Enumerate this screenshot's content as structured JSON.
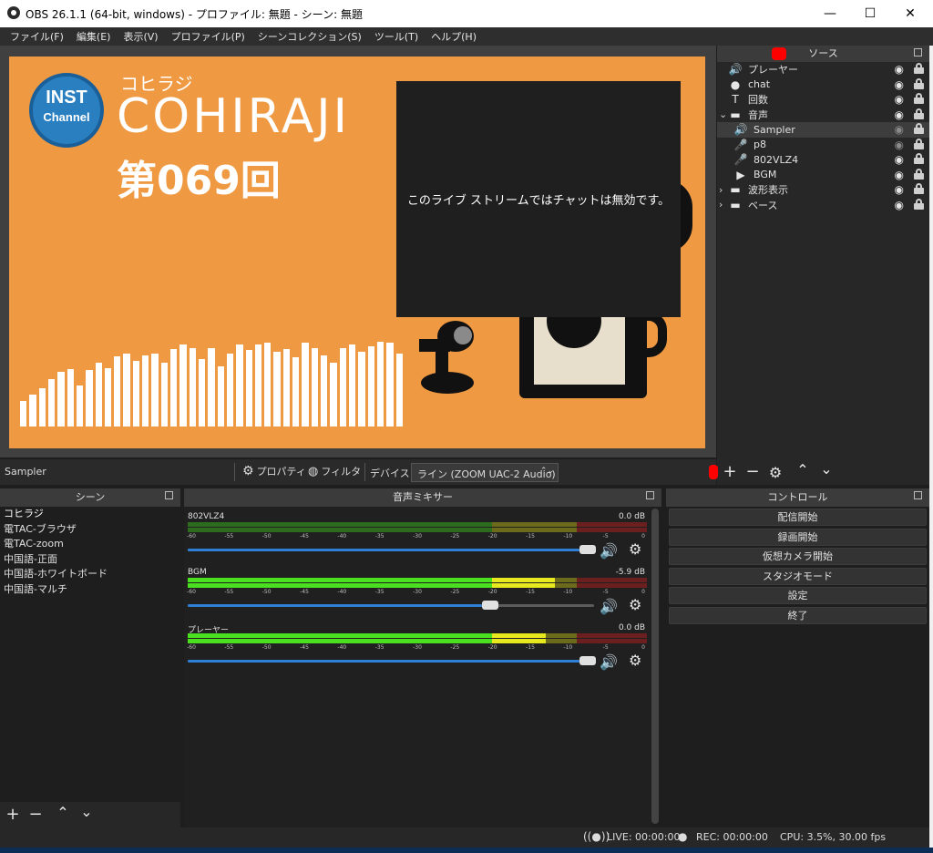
{
  "window": {
    "title": "OBS 26.1.1 (64-bit, windows) - プロファイル: 無題 - シーン: 無題",
    "minimize": "—",
    "maximize": "☐",
    "close": "✕"
  },
  "menu": [
    "ファイル(F)",
    "編集(E)",
    "表示(V)",
    "プロファイル(P)",
    "シーンコレクション(S)",
    "ツール(T)",
    "ヘルプ(H)"
  ],
  "preview": {
    "logo_line1": "INST",
    "logo_line2": "Channel",
    "show_kana": "コヒラジ",
    "show_name": "COHIRAJI",
    "episode": "第069回",
    "chat_message": "このライブ ストリームではチャットは無効です。",
    "visualizer_levels": [
      0.28,
      0.35,
      0.42,
      0.52,
      0.6,
      0.63,
      0.45,
      0.62,
      0.7,
      0.64,
      0.77,
      0.8,
      0.72,
      0.78,
      0.8,
      0.7,
      0.85,
      0.9,
      0.86,
      0.74,
      0.86,
      0.66,
      0.8,
      0.9,
      0.84,
      0.9,
      0.92,
      0.82,
      0.85,
      0.76,
      0.92,
      0.86,
      0.78,
      0.7,
      0.86,
      0.9,
      0.82,
      0.88,
      0.93,
      0.92,
      0.8
    ]
  },
  "sources": {
    "title": "ソース",
    "items": [
      {
        "name": "プレーヤー",
        "icon": "speaker-icon",
        "glyph": "🔊",
        "visible": true,
        "locked": true,
        "group": false,
        "indent": false,
        "selected": false
      },
      {
        "name": "chat",
        "icon": "globe-icon",
        "glyph": "●",
        "visible": true,
        "locked": true,
        "group": false,
        "indent": false,
        "selected": false
      },
      {
        "name": "回数",
        "icon": "text-icon",
        "glyph": "T",
        "visible": true,
        "locked": true,
        "group": false,
        "indent": false,
        "selected": false
      },
      {
        "name": "音声",
        "icon": "folder-icon",
        "glyph": "▬",
        "visible": true,
        "locked": true,
        "group": true,
        "expanded": true,
        "indent": false,
        "selected": false
      },
      {
        "name": "Sampler",
        "icon": "speaker-icon",
        "glyph": "🔊",
        "visible": false,
        "locked": true,
        "group": false,
        "indent": true,
        "selected": true
      },
      {
        "name": "p8",
        "icon": "mic-icon",
        "glyph": "🎤",
        "visible": false,
        "locked": true,
        "group": false,
        "indent": true,
        "selected": false
      },
      {
        "name": "802VLZ4",
        "icon": "mic-icon",
        "glyph": "🎤",
        "visible": true,
        "locked": true,
        "group": false,
        "indent": true,
        "selected": false
      },
      {
        "name": "BGM",
        "icon": "play-icon",
        "glyph": "▶",
        "visible": true,
        "locked": true,
        "group": false,
        "indent": true,
        "selected": false
      },
      {
        "name": "波形表示",
        "icon": "folder-icon",
        "glyph": "▬",
        "visible": true,
        "locked": true,
        "group": true,
        "expanded": false,
        "indent": false,
        "selected": false
      },
      {
        "name": "ベース",
        "icon": "folder-icon",
        "glyph": "▬",
        "visible": true,
        "locked": true,
        "group": true,
        "expanded": false,
        "indent": false,
        "selected": false
      }
    ]
  },
  "propbar": {
    "current_source": "Sampler",
    "properties": "プロパティ",
    "filters": "フィルタ",
    "device_label": "デバイス",
    "device_value": "ライン (ZOOM UAC-2 Audio)"
  },
  "scenes": {
    "title": "シーン",
    "items": [
      "コヒラジ",
      "電TAC-ブラウザ",
      "電TAC-zoom",
      "中国語-正面",
      "中国語-ホワイトボード",
      "中国語-マルチ"
    ],
    "active_index": 0
  },
  "mixer": {
    "title": "音声ミキサー",
    "ticks": [
      "-60",
      "-55",
      "-50",
      "-45",
      "-40",
      "-35",
      "-30",
      "-25",
      "-20",
      "-15",
      "-10",
      "-5",
      "0"
    ],
    "channels": [
      {
        "name": "802VLZ4",
        "db": "0.0 dB",
        "volume": 1.0,
        "level": 0.0
      },
      {
        "name": "BGM",
        "db": "-5.9 dB",
        "volume": 0.75,
        "level": 0.8
      },
      {
        "name": "プレーヤー",
        "db": "0.0 dB",
        "volume": 1.0,
        "level": 0.78
      }
    ]
  },
  "controls": {
    "title": "コントロール",
    "buttons": [
      "配信開始",
      "録画開始",
      "仮想カメラ開始",
      "スタジオモード",
      "設定",
      "終了"
    ]
  },
  "status": {
    "live": "LIVE: 00:00:00",
    "rec": "REC: 00:00:00",
    "cpu": "CPU: 3.5%, 30.00 fps"
  }
}
